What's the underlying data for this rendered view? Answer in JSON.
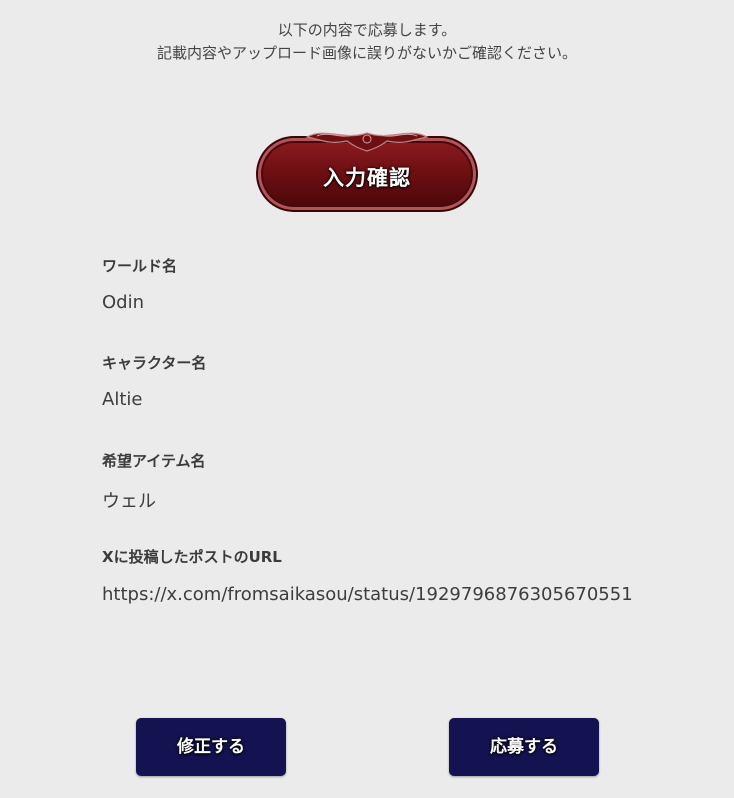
{
  "intro": {
    "line1": "以下の内容で応募します。",
    "line2": "記載内容やアップロード画像に誤りがないかご確認ください。"
  },
  "badge": {
    "label": "入力確認"
  },
  "fields": [
    {
      "label": "ワールド名",
      "value": "Odin"
    },
    {
      "label": "キャラクター名",
      "value": "Altie"
    },
    {
      "label": "希望アイテム名",
      "value": "ウェル"
    },
    {
      "label": "Xに投稿したポストのURL",
      "value": "https://x.com/fromsaikasou/status/1929796876305670551"
    }
  ],
  "buttons": {
    "fix_label": "修正する",
    "apply_label": "応募する"
  },
  "colors": {
    "background": "#ebebeb",
    "badge_red": "#6b0f12",
    "badge_border": "#b0565a",
    "button_navy": "#141250"
  }
}
